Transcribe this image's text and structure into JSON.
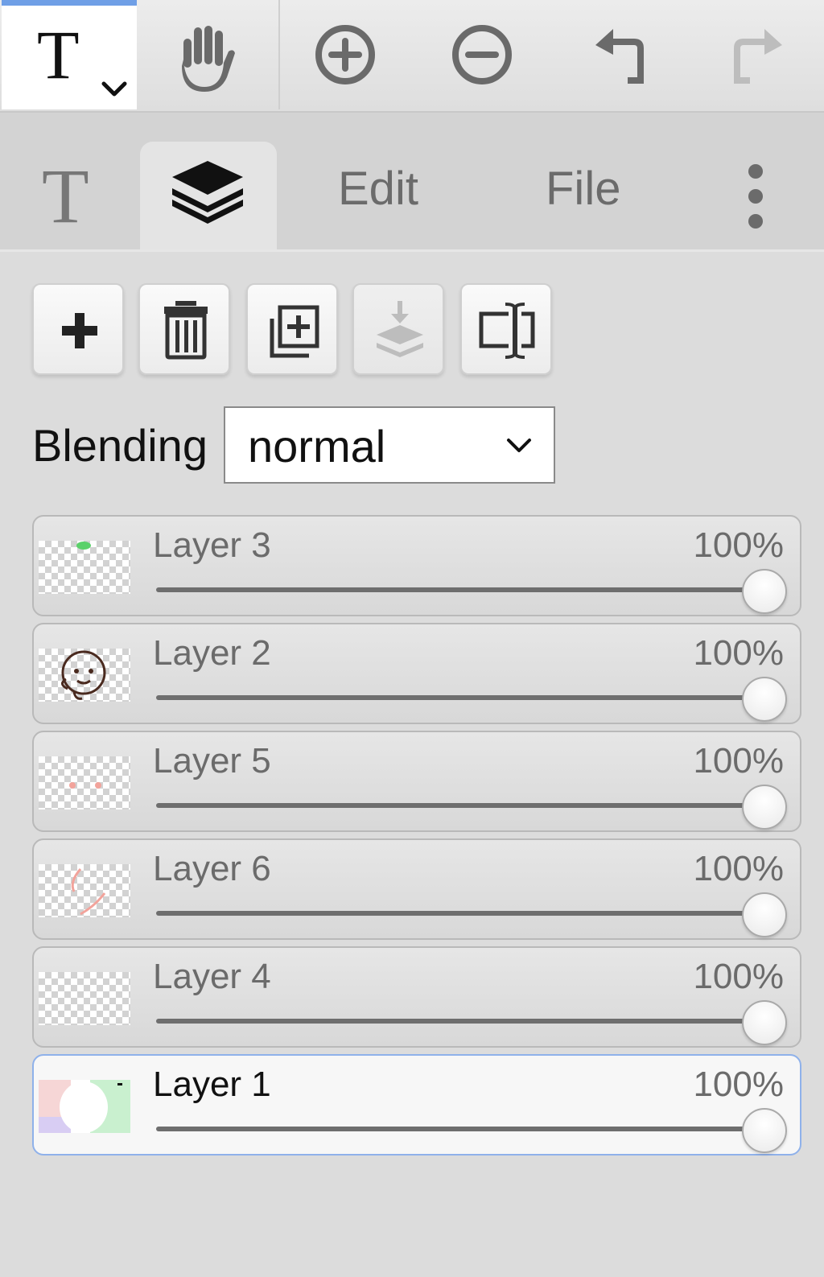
{
  "toolbar": {
    "active_tool": "T",
    "tools": [
      "text-tool",
      "hand-tool",
      "zoom-in",
      "zoom-out",
      "undo",
      "redo"
    ],
    "accent_color": "#6f9fe6"
  },
  "tabs": {
    "text_glyph": "T",
    "edit_label": "Edit",
    "file_label": "File",
    "active": "layers"
  },
  "layer_actions": [
    "add-layer",
    "delete-layer",
    "duplicate-layer",
    "merge-down",
    "rename-layer"
  ],
  "blending": {
    "label": "Blending",
    "value": "normal"
  },
  "layers": [
    {
      "name": "Layer 3",
      "opacity_label": "100%",
      "opacity": 1.0,
      "active": false
    },
    {
      "name": "Layer 2",
      "opacity_label": "100%",
      "opacity": 1.0,
      "active": false
    },
    {
      "name": "Layer 5",
      "opacity_label": "100%",
      "opacity": 1.0,
      "active": false
    },
    {
      "name": "Layer 6",
      "opacity_label": "100%",
      "opacity": 1.0,
      "active": false
    },
    {
      "name": "Layer 4",
      "opacity_label": "100%",
      "opacity": 1.0,
      "active": false
    },
    {
      "name": "Layer 1",
      "opacity_label": "100%",
      "opacity": 1.0,
      "active": true
    }
  ]
}
